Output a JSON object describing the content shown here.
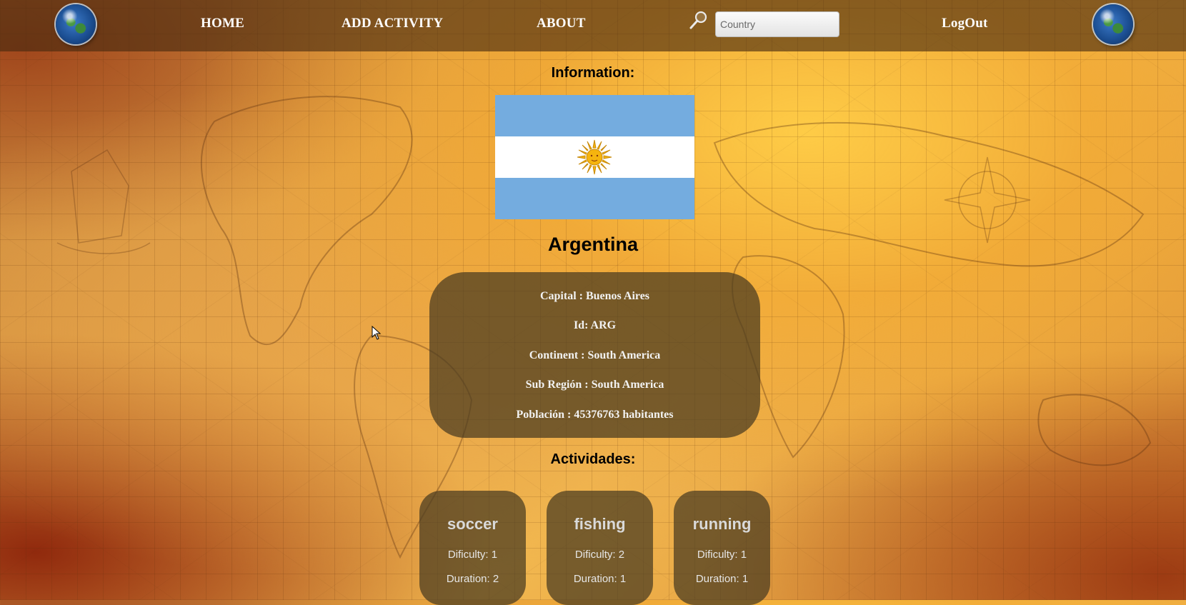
{
  "navbar": {
    "left_logo": "globe-icon",
    "right_logo": "globe-icon",
    "links": {
      "home": "HOME",
      "add_activity": "ADD ACTIVITY",
      "about": "ABOUT",
      "logout": "LogOut"
    },
    "search": {
      "icon": "magnifier-icon",
      "placeholder": "Country",
      "value": ""
    }
  },
  "detail": {
    "info_heading": "Information:",
    "flag": {
      "icon": "argentina-flag",
      "colors": {
        "blue": "#74acdf",
        "white": "#ffffff",
        "sun": "#f6b40e"
      }
    },
    "country_name": "Argentina",
    "info_lines": {
      "capital": "Capital : Buenos Aires",
      "id": "Id: ARG",
      "continent": "Continent : South America",
      "subregion": "Sub Región : South America",
      "population": "Población : 45376763 habitantes"
    },
    "activities_heading": "Actividades:",
    "activities": [
      {
        "name": "soccer",
        "difficulty": "Dificulty: 1",
        "duration": "Duration: 2"
      },
      {
        "name": "fishing",
        "difficulty": "Dificulty: 2",
        "duration": "Duration: 1"
      },
      {
        "name": "running",
        "difficulty": "Dificulty: 1",
        "duration": "Duration: 1"
      }
    ]
  },
  "colors": {
    "navbar_bg": "#46280f",
    "card_bg": "#483a20",
    "background_accent": "#e8a747"
  }
}
